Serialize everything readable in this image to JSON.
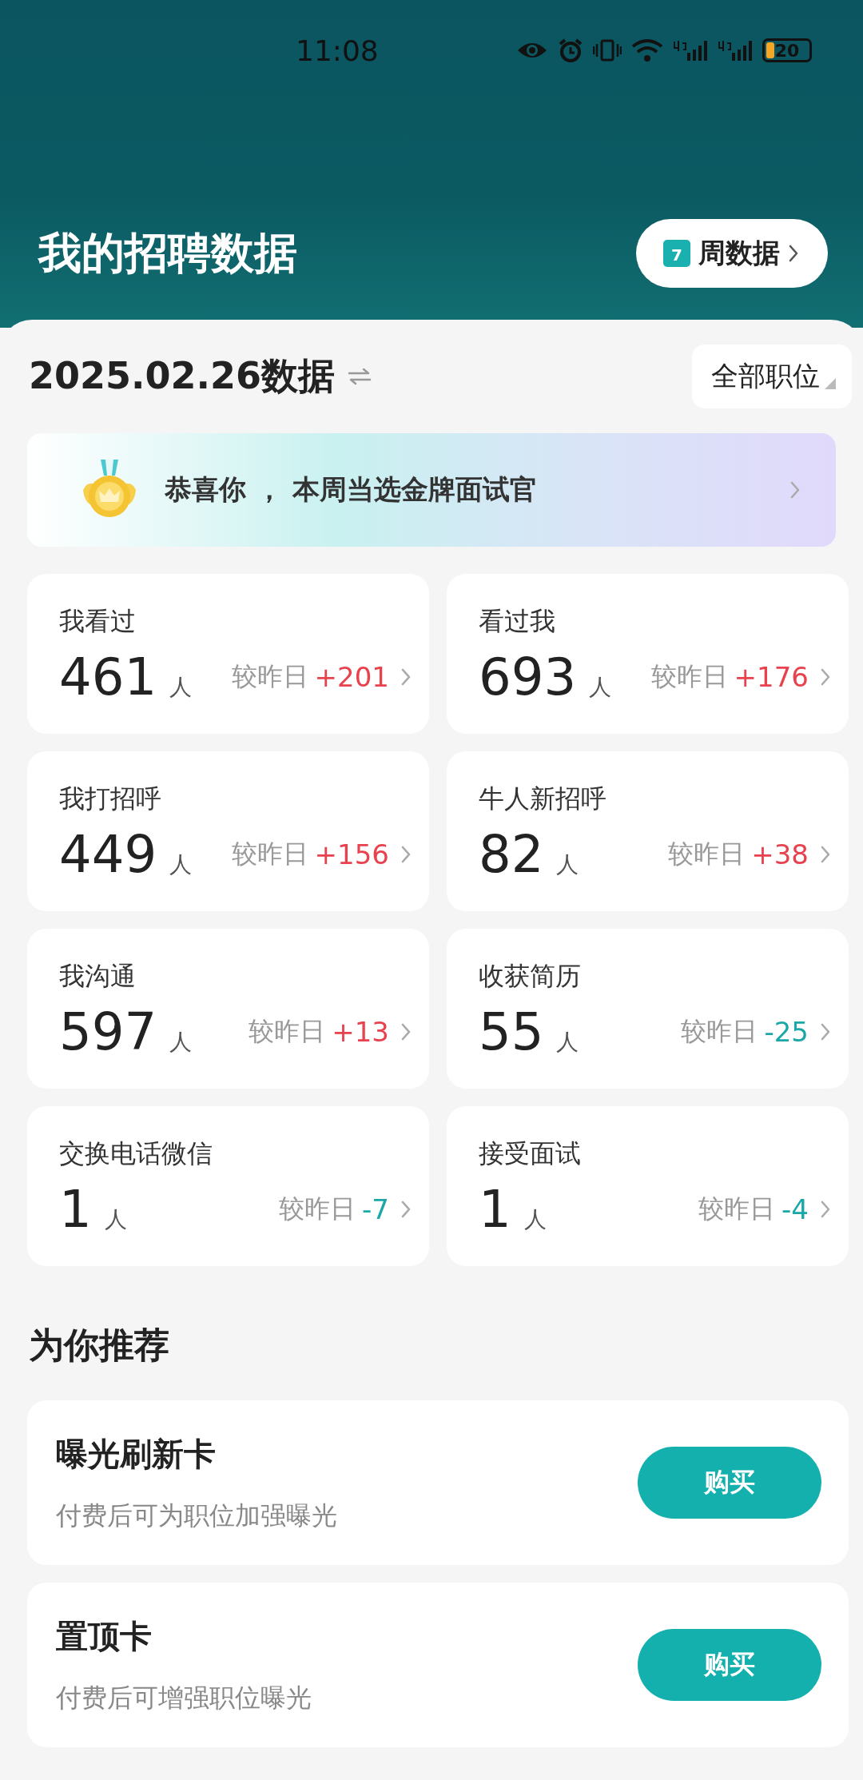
{
  "status_bar": {
    "time": "11:08",
    "battery": "20"
  },
  "header": {
    "title": "我的招聘数据",
    "week_button": {
      "icon_text": "7",
      "label": "周数据"
    }
  },
  "date_row": {
    "title": "2025.02.26数据",
    "filter": "全部职位"
  },
  "banner": {
    "text": "恭喜你 ， 本周当选金牌面试官"
  },
  "stats": [
    {
      "label": "我看过",
      "value": "461",
      "unit": "人",
      "compare": "较昨日",
      "delta": "+201",
      "color": "#e8424f"
    },
    {
      "label": "看过我",
      "value": "693",
      "unit": "人",
      "compare": "较昨日",
      "delta": "+176",
      "color": "#e8424f"
    },
    {
      "label": "我打招呼",
      "value": "449",
      "unit": "人",
      "compare": "较昨日",
      "delta": "+156",
      "color": "#e8424f"
    },
    {
      "label": "牛人新招呼",
      "value": "82",
      "unit": "人",
      "compare": "较昨日",
      "delta": "+38",
      "color": "#e8424f"
    },
    {
      "label": "我沟通",
      "value": "597",
      "unit": "人",
      "compare": "较昨日",
      "delta": "+13",
      "color": "#e8424f"
    },
    {
      "label": "收获简历",
      "value": "55",
      "unit": "人",
      "compare": "较昨日",
      "delta": "-25",
      "color": "#19a7a7"
    },
    {
      "label": "交换电话微信",
      "value": "1",
      "unit": "人",
      "compare": "较昨日",
      "delta": "-7",
      "color": "#19a7a7"
    },
    {
      "label": "接受面试",
      "value": "1",
      "unit": "人",
      "compare": "较昨日",
      "delta": "-4",
      "color": "#19a7a7"
    }
  ],
  "recommend": {
    "title": "为你推荐",
    "items": [
      {
        "title": "曝光刷新卡",
        "description": "付费后可为职位加强曝光",
        "button": "购买"
      },
      {
        "title": "置顶卡",
        "description": "付费后可增强职位曝光",
        "button": "购买"
      }
    ]
  }
}
